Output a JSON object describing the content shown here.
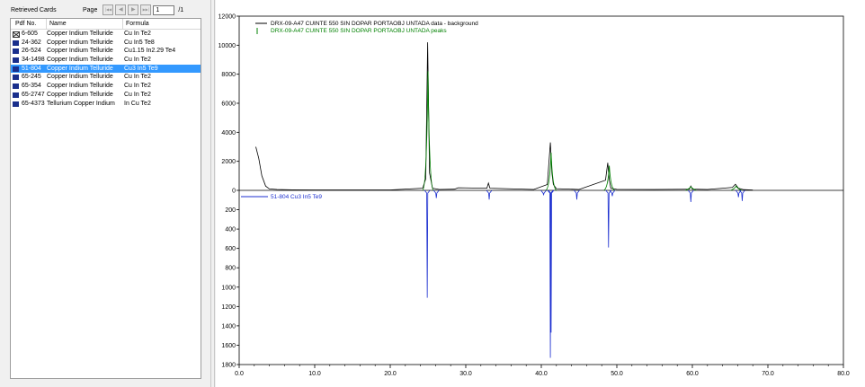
{
  "panel": {
    "title": "Retrieved Cards",
    "page_label": "Page",
    "page_value": "1",
    "page_total": "/1",
    "nav_first": "|◀◀",
    "nav_prev": "◀",
    "nav_next": "▶",
    "nav_last": "▶▶|"
  },
  "table": {
    "columns": [
      "Pdf No.",
      "Name",
      "Formula"
    ],
    "rows": [
      {
        "pdf": "6-605",
        "name": "Copper Indium Telluride",
        "formula": "Cu In Te2",
        "icon": "deleted-card-icon",
        "selected": false
      },
      {
        "pdf": "24-362",
        "name": "Copper Indium Telluride",
        "formula": "Cu In5 Te8",
        "icon": "card-icon",
        "selected": false
      },
      {
        "pdf": "26-524",
        "name": "Copper Indium Telluride",
        "formula": "Cu1.15 In2.29 Te4",
        "icon": "card-icon",
        "selected": false
      },
      {
        "pdf": "34-1498",
        "name": "Copper Indium Telluride",
        "formula": "Cu In Te2",
        "icon": "card-icon",
        "selected": false
      },
      {
        "pdf": "51-804",
        "name": "Copper Indium Telluride",
        "formula": "Cu3 In5 Te9",
        "icon": "card-icon",
        "selected": true
      },
      {
        "pdf": "65-245",
        "name": "Copper Indium Telluride",
        "formula": "Cu In Te2",
        "icon": "card-icon",
        "selected": false
      },
      {
        "pdf": "65-354",
        "name": "Copper Indium Telluride",
        "formula": "Cu In Te2",
        "icon": "card-icon",
        "selected": false
      },
      {
        "pdf": "65-2747",
        "name": "Copper Indium Telluride",
        "formula": "Cu In Te2",
        "icon": "card-icon",
        "selected": false
      },
      {
        "pdf": "65-4373",
        "name": "Tellurium Copper Indium",
        "formula": "In Cu Te2",
        "icon": "card-icon",
        "selected": false
      }
    ]
  },
  "chart_data": {
    "type": "line",
    "xlim": [
      0,
      80
    ],
    "x_ticks": [
      "0.0",
      "10.0",
      "20.0",
      "30.0",
      "40.0",
      "50.0",
      "60.0",
      "70.0",
      "80.0"
    ],
    "top_ylim": [
      0,
      12000
    ],
    "top_y_ticks": [
      "12000",
      "10000",
      "8000",
      "6000",
      "4000",
      "2000",
      "0"
    ],
    "bottom_ylim": [
      0,
      1800
    ],
    "bottom_y_ticks": [
      "200",
      "400",
      "600",
      "800",
      "1000",
      "1200",
      "1400",
      "1600",
      "1800"
    ],
    "legend": [
      {
        "label": "DRX-09-A47 CUINTE 550 SIN DOPAR PORTAOBJ UNTADA data - background",
        "color": "#000000",
        "marker": "line"
      },
      {
        "label": "DRX-09-A47 CUINTE 550 SIN DOPAR PORTAOBJ UNTADA peaks",
        "color": "#008000",
        "marker": "tick"
      }
    ],
    "reference_label": "51-804 Cu3 In5 Te9",
    "colors": {
      "data": "#000000",
      "peaks": "#008000",
      "reference": "#1c2fd0"
    },
    "series": [
      {
        "name": "DRX-09-A47 CUINTE 550 SIN DOPAR PORTAOBJ UNTADA data - background",
        "x": [
          2.2,
          2.6,
          3.0,
          3.5,
          4.0,
          5.0,
          7.0,
          10.0,
          15.0,
          20.0,
          24.3,
          24.7,
          24.95,
          25.2,
          25.6,
          26.5,
          28.5,
          29.0,
          32.8,
          33.0,
          33.2,
          39.0,
          40.8,
          41.2,
          41.4,
          41.6,
          42.0,
          45.0,
          48.5,
          48.8,
          49.0,
          49.2,
          50.0,
          55.0,
          59.6,
          59.8,
          60.0,
          62.0,
          65.3,
          65.7,
          66.1,
          66.8,
          68.0
        ],
        "y": [
          3000,
          2200,
          1000,
          300,
          100,
          60,
          40,
          30,
          30,
          30,
          150,
          800,
          10200,
          1200,
          150,
          60,
          80,
          180,
          150,
          500,
          150,
          60,
          400,
          3300,
          1200,
          400,
          120,
          60,
          700,
          1900,
          700,
          150,
          70,
          60,
          80,
          300,
          80,
          60,
          200,
          420,
          150,
          50,
          20
        ]
      },
      {
        "name": "DRX-09-A47 CUINTE 550 SIN DOPAR PORTAOBJ UNTADA peaks",
        "x": [
          25.0,
          41.3,
          49.0,
          59.8,
          65.8
        ],
        "y": [
          8200,
          2600,
          1700,
          250,
          300
        ]
      },
      {
        "name": "51-804 Cu3 In5 Te9",
        "x": [
          24.9,
          26.1,
          33.1,
          40.3,
          41.2,
          41.3,
          44.7,
          48.9,
          49.4,
          59.8,
          66.1,
          66.6
        ],
        "y": [
          1110,
          80,
          95,
          45,
          1730,
          1470,
          95,
          590,
          60,
          120,
          70,
          110
        ]
      }
    ]
  }
}
